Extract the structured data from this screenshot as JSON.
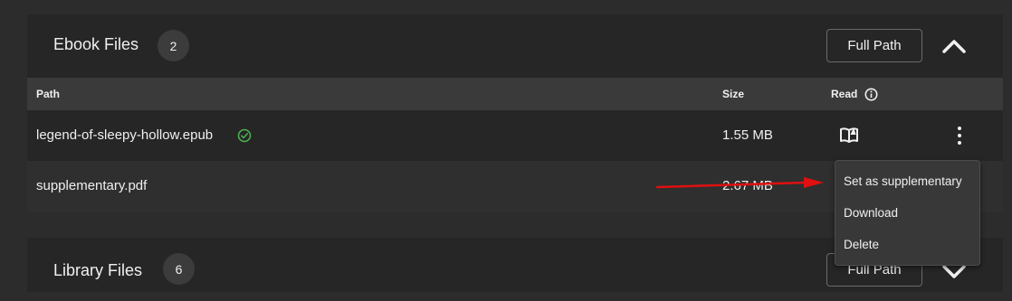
{
  "ebook_files": {
    "title": "Ebook Files",
    "count": "2",
    "full_path_label": "Full Path",
    "columns": {
      "path": "Path",
      "size": "Size",
      "read": "Read"
    },
    "rows": [
      {
        "path": "legend-of-sleepy-hollow.epub",
        "size": "1.55 MB",
        "verified": true
      },
      {
        "path": "supplementary.pdf",
        "size": "2.67 MB",
        "verified": false
      }
    ]
  },
  "context_menu": {
    "items": [
      "Set as supplementary",
      "Download",
      "Delete"
    ]
  },
  "library_files": {
    "title": "Library Files",
    "count": "6",
    "full_path_label": "Full Path"
  },
  "colors": {
    "accent_check": "#4caf50",
    "annotation_arrow": "#e01010"
  },
  "icons": [
    "chevron-up-icon",
    "chevron-down-icon",
    "info-icon",
    "check-circle-icon",
    "book-read-icon",
    "kebab-menu-icon"
  ]
}
